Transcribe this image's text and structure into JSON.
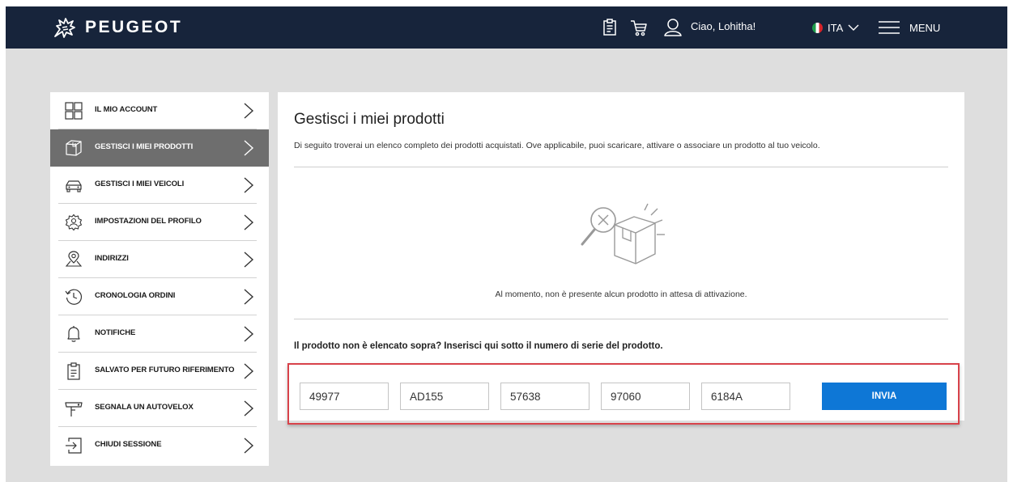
{
  "header": {
    "brand": "PEUGEOT",
    "greeting": "Ciao, Lohitha!",
    "language": "ITA",
    "menu_label": "MENU",
    "icons": [
      "lion-logo-icon",
      "clipboard-icon",
      "cart-icon",
      "user-icon",
      "italy-flag-icon",
      "chevron-down-icon",
      "hamburger-icon"
    ]
  },
  "sidebar": {
    "items": [
      {
        "label": "IL MIO ACCOUNT",
        "icon": "grid-icon",
        "active": false
      },
      {
        "label": "GESTISCI I MIEI PRODOTTI",
        "icon": "box-icon",
        "active": true
      },
      {
        "label": "GESTISCI I MIEI VEICOLI",
        "icon": "car-icon",
        "active": false
      },
      {
        "label": "IMPOSTAZIONI DEL PROFILO",
        "icon": "gear-icon",
        "active": false
      },
      {
        "label": "INDIRIZZI",
        "icon": "location-pin-icon",
        "active": false
      },
      {
        "label": "CRONOLOGIA ORDINI",
        "icon": "history-icon",
        "active": false
      },
      {
        "label": "NOTIFICHE",
        "icon": "bell-icon",
        "active": false
      },
      {
        "label": "SALVATO PER FUTURO RIFERIMENTO",
        "icon": "clipboard-icon",
        "active": false
      },
      {
        "label": "SEGNALA UN AUTOVELOX",
        "icon": "speed-camera-icon",
        "active": false
      },
      {
        "label": "CHIUDI SESSIONE",
        "icon": "logout-icon",
        "active": false
      }
    ]
  },
  "main": {
    "title": "Gestisci i miei prodotti",
    "description": "Di seguito troverai un elenco completo dei prodotti acquistati. Ove applicabile, puoi scaricare, attivare o associare un prodotto al tuo veicolo.",
    "empty_message": "Al momento, non è presente alcun prodotto in attesa di attivazione.",
    "serial_prompt": "Il prodotto non è elencato sopra? Inserisci qui sotto il numero di serie del prodotto.",
    "serial_values": [
      "49977",
      "AD155",
      "57638",
      "97060",
      "6184A"
    ],
    "submit_label": "INVIA"
  },
  "colors": {
    "header_bg": "#17243b",
    "page_bg": "#dedede",
    "active_item_bg": "#6e6e6e",
    "button_blue": "#0e77d6",
    "highlight_red": "#d8424a"
  }
}
